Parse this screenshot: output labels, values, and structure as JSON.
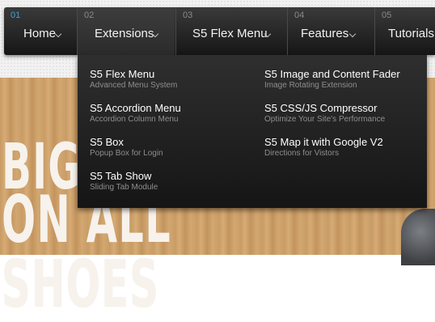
{
  "nav": {
    "items": [
      {
        "num": "01",
        "label": "Home"
      },
      {
        "num": "02",
        "label": "Extensions"
      },
      {
        "num": "03",
        "label": "S5 Flex Menu"
      },
      {
        "num": "04",
        "label": "Features"
      },
      {
        "num": "05",
        "label": "Tutorials"
      }
    ],
    "active_index": 1
  },
  "dropdown": {
    "left_column": [
      {
        "title": "S5 Flex Menu",
        "subtitle": "Advanced Menu System"
      },
      {
        "title": "S5 Accordion Menu",
        "subtitle": "Accordion Column Menu"
      },
      {
        "title": "S5 Box",
        "subtitle": "Popup Box for Login"
      },
      {
        "title": "S5 Tab Show",
        "subtitle": "Sliding Tab Module"
      }
    ],
    "right_column": [
      {
        "title": "S5 Image and Content Fader",
        "subtitle": "Image Rotating Extension"
      },
      {
        "title": "S5 CSS/JS Compressor",
        "subtitle": "Optimize Your Site's Performance"
      },
      {
        "title": "S5 Map it with Google V2",
        "subtitle": "Directions for Vistors"
      }
    ]
  },
  "hero": {
    "line1": "BIG",
    "line2": "ON ALL SHOES"
  },
  "colors": {
    "accent": "#3aa4d8",
    "nav_bg": "#1e1e1e",
    "wood": "#c99a61"
  }
}
